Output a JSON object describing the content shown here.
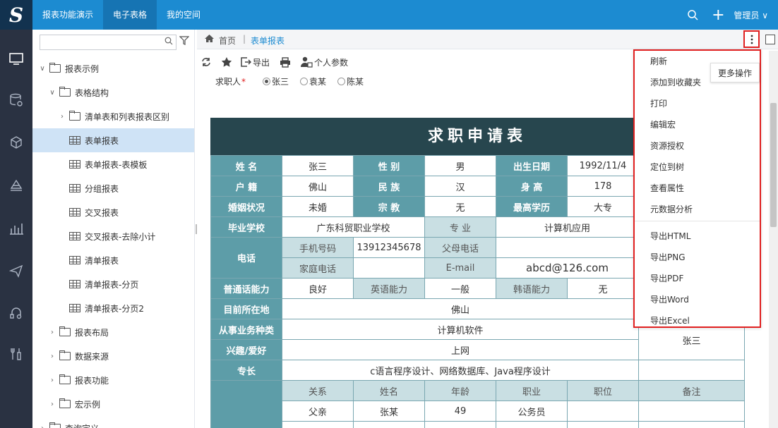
{
  "topbar": {
    "logo": "S",
    "tabs": [
      {
        "label": "报表功能演示"
      },
      {
        "label": "电子表格"
      },
      {
        "label": "我的空间"
      }
    ],
    "user": "管理员 ∨"
  },
  "tree": {
    "search": {
      "value": "",
      "placeholder": ""
    },
    "nodes": [
      {
        "label": "报表示例"
      },
      {
        "label": "表格结构"
      },
      {
        "label": "清单表和列表报表区别"
      },
      {
        "label": "表单报表"
      },
      {
        "label": "表单报表-表模板"
      },
      {
        "label": "分组报表"
      },
      {
        "label": "交叉报表"
      },
      {
        "label": "交叉报表-去除小计"
      },
      {
        "label": "清单报表"
      },
      {
        "label": "清单报表-分页"
      },
      {
        "label": "清单报表-分页2"
      },
      {
        "label": "报表布局"
      },
      {
        "label": "数据来源"
      },
      {
        "label": "报表功能"
      },
      {
        "label": "宏示例"
      },
      {
        "label": "查询定义"
      }
    ]
  },
  "breadcrumb": {
    "home": "首页",
    "current": "表单报表",
    "sep": "|"
  },
  "toolbar": {
    "export": "导出",
    "params": "个人参数"
  },
  "params": {
    "label": "求职人",
    "required": "*",
    "options": [
      {
        "label": "张三"
      },
      {
        "label": "袁某"
      },
      {
        "label": "陈某"
      }
    ]
  },
  "report": {
    "title": "求职申请表",
    "r1": [
      "姓  名",
      "张三",
      "性  别",
      "男",
      "出生日期",
      "1992/11/4"
    ],
    "r2": [
      "户  籍",
      "佛山",
      "民  族",
      "汉",
      "身  高",
      "178"
    ],
    "r3": [
      "婚姻状况",
      "未婚",
      "宗  教",
      "无",
      "最高学历",
      "大专"
    ],
    "r4": [
      "毕业学校",
      "广东科贸职业学校",
      "专  业",
      "计算机应用"
    ],
    "phone_label": "电话",
    "r5": [
      "手机号码",
      "13912345678",
      "父母电话",
      ""
    ],
    "r6": [
      "家庭电话",
      "",
      "E-mail",
      "abcd@126.com"
    ],
    "r7": [
      "普通话能力",
      "良好",
      "英语能力",
      "一般",
      "韩语能力",
      "无"
    ],
    "r8": [
      "目前所在地",
      "佛山"
    ],
    "r9": [
      "从事业务种类",
      "计算机软件"
    ],
    "r10": [
      "兴趣/爱好",
      "上网"
    ],
    "r11": [
      "专长",
      "c语言程序设计、网络数据库、Java程序设计"
    ],
    "photo_name": "张三",
    "family_headers": [
      "关系",
      "姓名",
      "年龄",
      "职业",
      "职位",
      "备注"
    ],
    "family_rows": [
      [
        "父亲",
        "张某",
        "49",
        "公务员",
        "",
        ""
      ]
    ]
  },
  "menu": {
    "items": [
      {
        "label": "刷新"
      },
      {
        "label": "添加到收藏夹"
      },
      {
        "label": "打印"
      },
      {
        "label": "编辑宏"
      },
      {
        "label": "资源授权"
      },
      {
        "label": "定位到树"
      },
      {
        "label": "查看属性"
      },
      {
        "label": "元数据分析"
      },
      {
        "label": "导出HTML"
      },
      {
        "label": "导出PNG"
      },
      {
        "label": "导出PDF"
      },
      {
        "label": "导出Word"
      },
      {
        "label": "导出Excel"
      }
    ],
    "tooltip": "更多操作"
  },
  "colors": {
    "accent": "#1c8bd1",
    "rail": "#2a3242",
    "report_header": "#27464e",
    "cell_header": "#5d9da8",
    "highlight": "#e02020"
  }
}
